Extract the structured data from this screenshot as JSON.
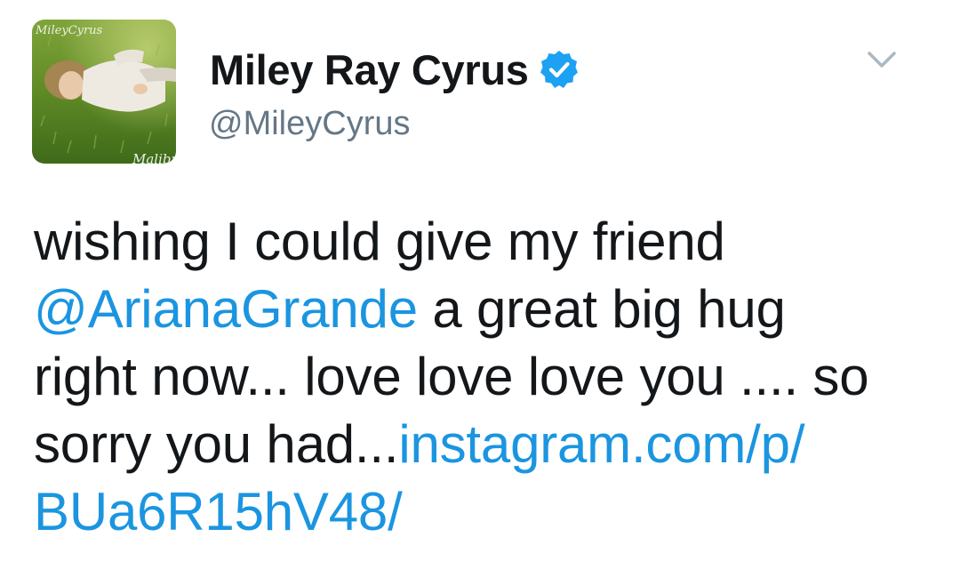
{
  "tweet": {
    "display_name": "Miley Ray Cyrus",
    "handle": "@MileyCyrus",
    "verified": true,
    "avatar": {
      "caption": "Malibu",
      "description": "profile photo"
    },
    "text": {
      "line1": "wishing I could give my friend",
      "mention": "@ArianaGrande",
      "line2_rest": " a great big hug",
      "line3": "right now... love love love you .... so",
      "line4_start": "sorry you had...",
      "link_part1": "instagram.com/p/",
      "link_part2": "BUa6R15hV48/"
    }
  },
  "icons": {
    "verified": "verified-badge-icon",
    "menu": "chevron-down-icon"
  },
  "colors": {
    "text": "#14171a",
    "secondary": "#657786",
    "link": "#1b95e0",
    "verified": "#1da1f2",
    "caret": "#aab8c2"
  }
}
